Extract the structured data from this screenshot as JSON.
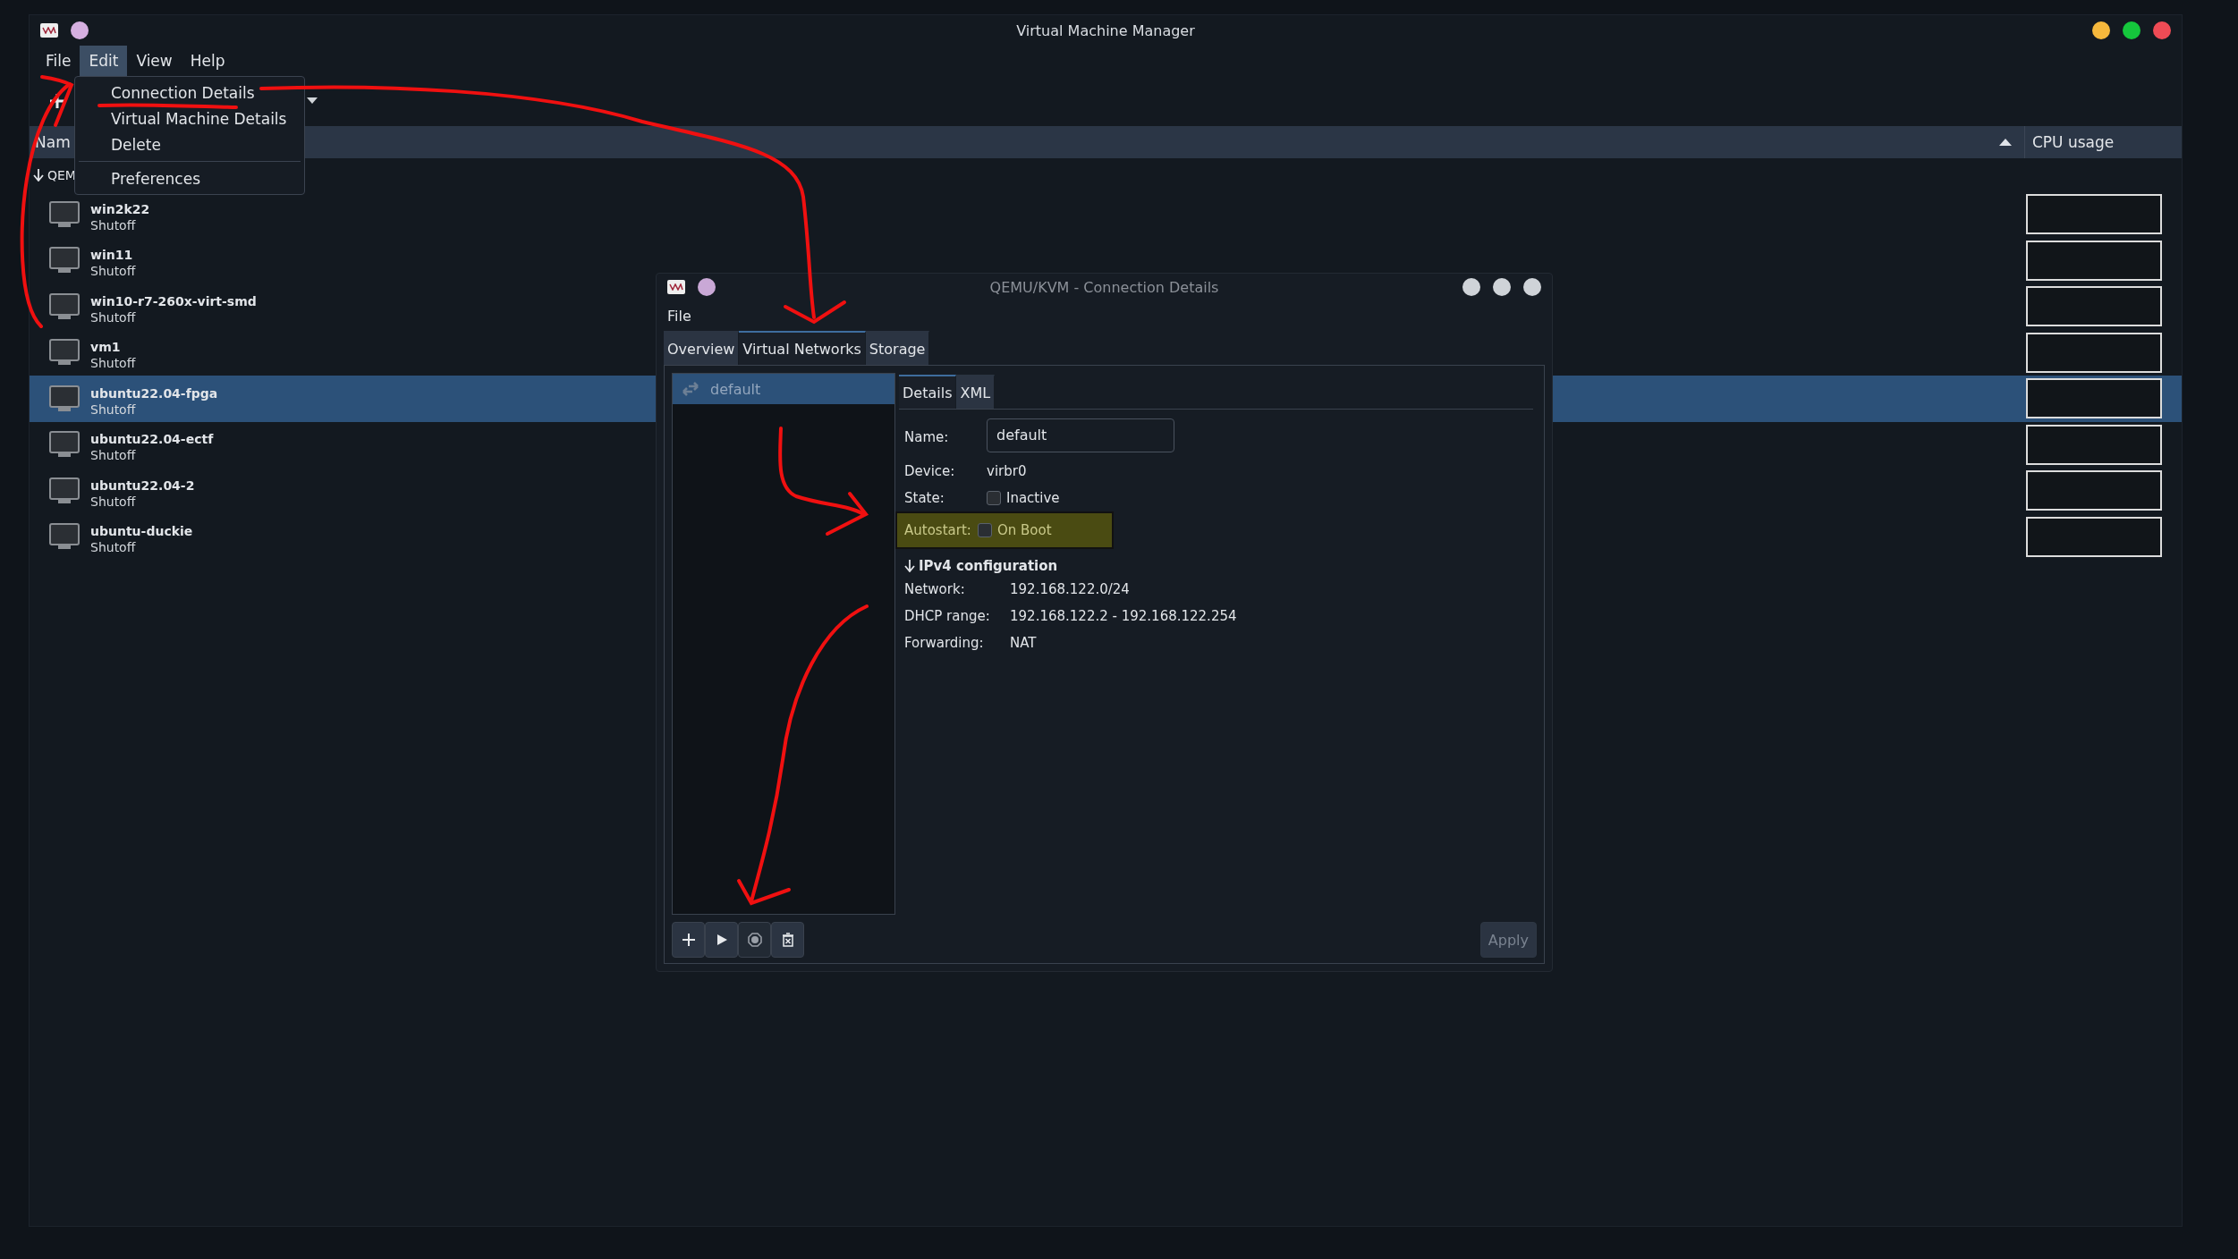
{
  "window": {
    "title": "Virtual Machine Manager"
  },
  "menu_bar": [
    {
      "label": "File",
      "selected": false
    },
    {
      "label": "Edit",
      "selected": true
    },
    {
      "label": "View",
      "selected": false
    },
    {
      "label": "Help",
      "selected": false
    }
  ],
  "edit_menu": {
    "groups": [
      [
        "Connection Details",
        "Virtual Machine Details",
        "Delete"
      ],
      [
        "Preferences"
      ]
    ]
  },
  "table": {
    "columns": [
      "Nam",
      "CPU usage"
    ],
    "group": {
      "label": "QEM",
      "expanded": true
    },
    "rows": [
      {
        "name": "win2k22",
        "status": "Shutoff",
        "selected": false
      },
      {
        "name": "win11",
        "status": "Shutoff",
        "selected": false
      },
      {
        "name": "win10-r7-260x-virt-smd",
        "status": "Shutoff",
        "selected": false
      },
      {
        "name": "vm1",
        "status": "Shutoff",
        "selected": false
      },
      {
        "name": "ubuntu22.04-fpga",
        "status": "Shutoff",
        "selected": true
      },
      {
        "name": "ubuntu22.04-ectf",
        "status": "Shutoff",
        "selected": false
      },
      {
        "name": "ubuntu22.04-2",
        "status": "Shutoff",
        "selected": false
      },
      {
        "name": "ubuntu-duckie",
        "status": "Shutoff",
        "selected": false
      }
    ]
  },
  "dialog": {
    "title": "QEMU/KVM - Connection Details",
    "menu": [
      "File"
    ],
    "tabs": [
      {
        "label": "Overview",
        "selected": false
      },
      {
        "label": "Virtual Networks",
        "selected": true
      },
      {
        "label": "Storage",
        "selected": false
      }
    ],
    "networks": [
      {
        "name": "default",
        "selected": true,
        "active": false
      }
    ],
    "detail_tabs": [
      {
        "label": "Details",
        "selected": true
      },
      {
        "label": "XML",
        "selected": false
      }
    ],
    "fields": [
      {
        "kind": "input",
        "label": "Name:",
        "value": "default"
      },
      {
        "kind": "text",
        "label": "Device:",
        "value": "virbr0"
      },
      {
        "kind": "checkbox",
        "label": "State:",
        "value": "Inactive",
        "checked": false,
        "highlighted": false
      },
      {
        "kind": "checkbox",
        "label": "Autostart:",
        "value": "On Boot",
        "checked": false,
        "highlighted": true
      }
    ],
    "ipv4": {
      "title": "IPv4 configuration",
      "expanded": true,
      "rows": [
        {
          "label": "Network:",
          "value": "192.168.122.0/24"
        },
        {
          "label": "DHCP range:",
          "value": "192.168.122.2 - 192.168.122.254"
        },
        {
          "label": "Forwarding:",
          "value": "NAT"
        }
      ]
    },
    "buttons": [
      {
        "kind": "add",
        "disabled": false
      },
      {
        "kind": "start",
        "disabled": false
      },
      {
        "kind": "stop",
        "disabled": true
      },
      {
        "kind": "delete",
        "disabled": false
      }
    ],
    "apply": {
      "label": "Apply",
      "disabled": true
    }
  }
}
